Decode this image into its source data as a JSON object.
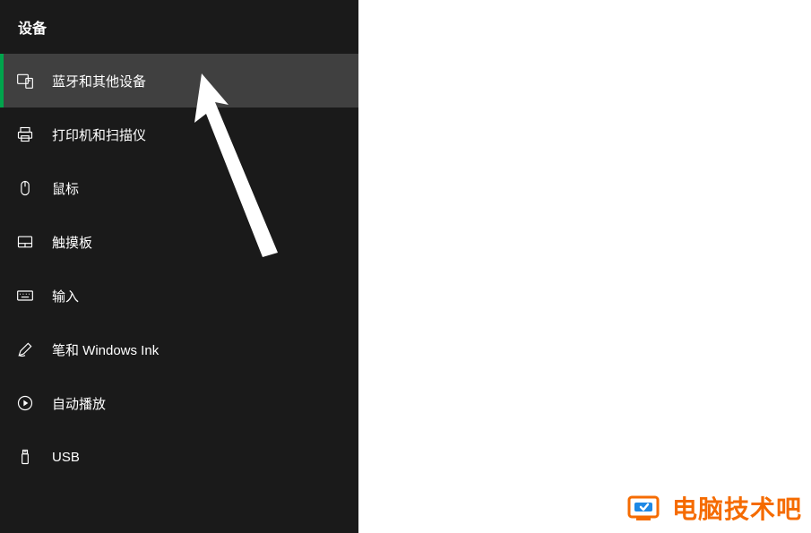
{
  "sidebar": {
    "header": "设备",
    "items": [
      {
        "label": "蓝牙和其他设备",
        "icon": "devices-icon",
        "selected": true
      },
      {
        "label": "打印机和扫描仪",
        "icon": "printer-icon",
        "selected": false
      },
      {
        "label": "鼠标",
        "icon": "mouse-icon",
        "selected": false
      },
      {
        "label": "触摸板",
        "icon": "touchpad-icon",
        "selected": false
      },
      {
        "label": "输入",
        "icon": "keyboard-icon",
        "selected": false
      },
      {
        "label": "笔和 Windows Ink",
        "icon": "pen-icon",
        "selected": false
      },
      {
        "label": "自动播放",
        "icon": "autoplay-icon",
        "selected": false
      },
      {
        "label": "USB",
        "icon": "usb-icon",
        "selected": false
      }
    ]
  },
  "watermark": {
    "text": "电脑技术吧"
  }
}
